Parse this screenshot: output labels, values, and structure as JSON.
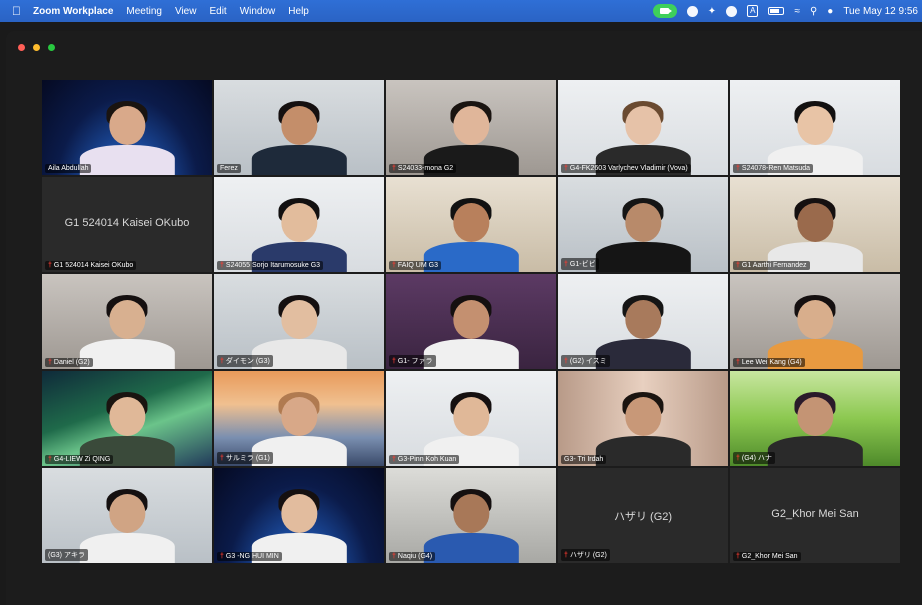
{
  "menubar": {
    "app_name": "Zoom Workplace",
    "menus": [
      "Meeting",
      "View",
      "Edit",
      "Window",
      "Help"
    ],
    "clock": "Tue May 12 9:56"
  },
  "colors": {
    "menubar": "#2a63c4",
    "active_speaker": "#28b84a",
    "mic_muted": "#ff3b30"
  },
  "participants": [
    {
      "name": "Aila Abdullah",
      "muted": false,
      "bg": "space",
      "skin": "#d9a98a",
      "shirt": "#e8e0f0",
      "hair": "#1a1410",
      "active": false
    },
    {
      "name": "Ferez",
      "muted": false,
      "bg": "office",
      "skin": "#c48e6a",
      "shirt": "#1e2a3a",
      "hair": "#151010",
      "active": true
    },
    {
      "name": "S24033-mona G2",
      "muted": true,
      "bg": "room",
      "skin": "#e0b69a",
      "shirt": "#1a1a1a",
      "hair": "#1a1410",
      "active": false
    },
    {
      "name": "G4-FK2603 Varlychev Vladimir (Vova)",
      "muted": true,
      "bg": "white",
      "skin": "#e6c2a8",
      "shirt": "#2a2a2a",
      "hair": "#6a4a30",
      "active": false
    },
    {
      "name": "S24078-Ren Matsuda",
      "muted": true,
      "bg": "white",
      "skin": "#e8c4a6",
      "shirt": "#f0f0f0",
      "hair": "#121010",
      "active": false
    },
    {
      "name": "G1 524014 Kaisei OKubo",
      "muted": true,
      "bg": "dark",
      "center": "G1 524014 Kaisei OKubo",
      "active": false
    },
    {
      "name": "S24055 Sorjo Itarumosuke G3",
      "muted": true,
      "bg": "white",
      "skin": "#e2bc9c",
      "shirt": "#2a3a6a",
      "hair": "#121010",
      "active": false
    },
    {
      "name": "FAIQ UM G3",
      "muted": true,
      "bg": "beige",
      "skin": "#b8805c",
      "shirt": "#2a6ac8",
      "hair": "#111111",
      "active": false
    },
    {
      "name": "G1-ビビ",
      "muted": true,
      "bg": "office",
      "skin": "#b88a6a",
      "shirt": "#151515",
      "hair": "#151515",
      "active": false
    },
    {
      "name": "G1 Aarthi Fernandez",
      "muted": true,
      "bg": "beige",
      "skin": "#9a6a4c",
      "shirt": "#e8e8e8",
      "hair": "#151010",
      "active": false
    },
    {
      "name": "Daniel (G2)",
      "muted": true,
      "bg": "room",
      "skin": "#d8b090",
      "shirt": "#f0f0f0",
      "hair": "#151010",
      "active": false
    },
    {
      "name": "ダイモン (G3)",
      "muted": true,
      "bg": "office",
      "skin": "#e2bea0",
      "shirt": "#e8e8e8",
      "hair": "#151010",
      "active": false
    },
    {
      "name": "G1- ファラ",
      "muted": true,
      "bg": "purple",
      "skin": "#c49070",
      "shirt": "#f0f0f0",
      "hair": "#151010",
      "active": false
    },
    {
      "name": "(G2) イスミ",
      "muted": true,
      "bg": "white",
      "skin": "#a87a5c",
      "shirt": "#2a2a3a",
      "hair": "#151515",
      "active": false
    },
    {
      "name": "Lee Wei Kang (G4)",
      "muted": true,
      "bg": "room",
      "skin": "#d8ae8c",
      "shirt": "#e89a40",
      "hair": "#151010",
      "active": false
    },
    {
      "name": "G4-LIEW Zi QING",
      "muted": true,
      "bg": "aurora",
      "skin": "#e0b898",
      "shirt": "#3a4a3a",
      "hair": "#1a1410",
      "active": false
    },
    {
      "name": "サルミラ (G1)",
      "muted": true,
      "bg": "sunset",
      "skin": "#d8a888",
      "shirt": "#f0f0f0",
      "hair": "#b07a50",
      "active": false
    },
    {
      "name": "G3-Pinn Koh Kuan",
      "muted": true,
      "bg": "white",
      "skin": "#e0b898",
      "shirt": "#f0f0f0",
      "hair": "#151010",
      "active": false
    },
    {
      "name": "G3- Tri Irdah",
      "muted": false,
      "bg": "curtain",
      "skin": "#c89878",
      "shirt": "#2a2a2a",
      "hair": "#1a1410",
      "active": false
    },
    {
      "name": "(G4) ハナ",
      "muted": true,
      "bg": "grass",
      "skin": "#c49474",
      "shirt": "#2a2a2a",
      "hair": "#2a1a2a",
      "active": false
    },
    {
      "name": "(G3) アキラ",
      "muted": false,
      "bg": "office",
      "skin": "#d0a484",
      "shirt": "#f0f0f0",
      "hair": "#151010",
      "active": false
    },
    {
      "name": "G3 -NG HUI MIN",
      "muted": true,
      "bg": "space",
      "skin": "#e2bc9e",
      "shirt": "#f0f0f0",
      "hair": "#151010",
      "active": false
    },
    {
      "name": "Naqiu (G4)",
      "muted": true,
      "bg": "lab",
      "skin": "#a87858",
      "shirt": "#2a5ab0",
      "hair": "#151010",
      "active": false
    },
    {
      "name": "ハザリ (G2)",
      "muted": true,
      "bg": "dark",
      "center": "ハザリ (G2)",
      "active": false
    },
    {
      "name": "G2_Khor Mei San",
      "muted": true,
      "bg": "dark",
      "center": "G2_Khor Mei San",
      "active": false
    }
  ]
}
